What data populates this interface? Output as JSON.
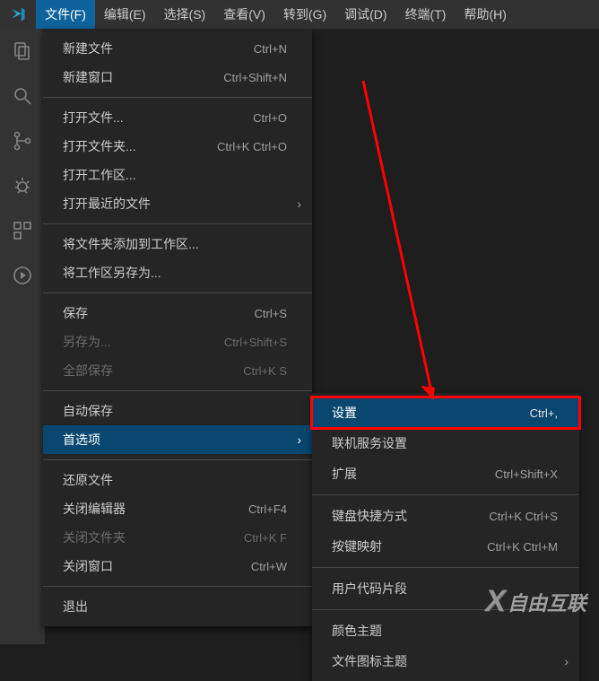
{
  "menubar": {
    "items": [
      {
        "label": "文件(F)",
        "active": true
      },
      {
        "label": "编辑(E)",
        "active": false
      },
      {
        "label": "选择(S)",
        "active": false
      },
      {
        "label": "查看(V)",
        "active": false
      },
      {
        "label": "转到(G)",
        "active": false
      },
      {
        "label": "调试(D)",
        "active": false
      },
      {
        "label": "终端(T)",
        "active": false
      },
      {
        "label": "帮助(H)",
        "active": false
      }
    ]
  },
  "dropdown": [
    {
      "type": "item",
      "label": "新建文件",
      "shortcut": "Ctrl+N"
    },
    {
      "type": "item",
      "label": "新建窗口",
      "shortcut": "Ctrl+Shift+N"
    },
    {
      "type": "sep"
    },
    {
      "type": "item",
      "label": "打开文件...",
      "shortcut": "Ctrl+O"
    },
    {
      "type": "item",
      "label": "打开文件夹...",
      "shortcut": "Ctrl+K Ctrl+O"
    },
    {
      "type": "item",
      "label": "打开工作区..."
    },
    {
      "type": "item",
      "label": "打开最近的文件",
      "submenu": true
    },
    {
      "type": "sep"
    },
    {
      "type": "item",
      "label": "将文件夹添加到工作区..."
    },
    {
      "type": "item",
      "label": "将工作区另存为..."
    },
    {
      "type": "sep"
    },
    {
      "type": "item",
      "label": "保存",
      "shortcut": "Ctrl+S"
    },
    {
      "type": "item",
      "label": "另存为...",
      "shortcut": "Ctrl+Shift+S",
      "disabled": true
    },
    {
      "type": "item",
      "label": "全部保存",
      "shortcut": "Ctrl+K S",
      "disabled": true
    },
    {
      "type": "sep"
    },
    {
      "type": "item",
      "label": "自动保存"
    },
    {
      "type": "item",
      "label": "首选项",
      "submenu": true,
      "highlight": true
    },
    {
      "type": "sep"
    },
    {
      "type": "item",
      "label": "还原文件"
    },
    {
      "type": "item",
      "label": "关闭编辑器",
      "shortcut": "Ctrl+F4"
    },
    {
      "type": "item",
      "label": "关闭文件夹",
      "shortcut": "Ctrl+K F",
      "disabled": true
    },
    {
      "type": "item",
      "label": "关闭窗口",
      "shortcut": "Ctrl+W"
    },
    {
      "type": "sep"
    },
    {
      "type": "item",
      "label": "退出"
    }
  ],
  "submenu": [
    {
      "type": "item",
      "label": "设置",
      "shortcut": "Ctrl+,",
      "highlight": true
    },
    {
      "type": "item",
      "label": "联机服务设置"
    },
    {
      "type": "item",
      "label": "扩展",
      "shortcut": "Ctrl+Shift+X"
    },
    {
      "type": "sep"
    },
    {
      "type": "item",
      "label": "键盘快捷方式",
      "shortcut": "Ctrl+K Ctrl+S"
    },
    {
      "type": "item",
      "label": "按键映射",
      "shortcut": "Ctrl+K Ctrl+M"
    },
    {
      "type": "sep"
    },
    {
      "type": "item",
      "label": "用户代码片段"
    },
    {
      "type": "sep"
    },
    {
      "type": "item",
      "label": "颜色主题"
    },
    {
      "type": "item",
      "label": "文件图标主题",
      "submenu": true
    }
  ],
  "watermark": {
    "brand": "自由互联"
  }
}
